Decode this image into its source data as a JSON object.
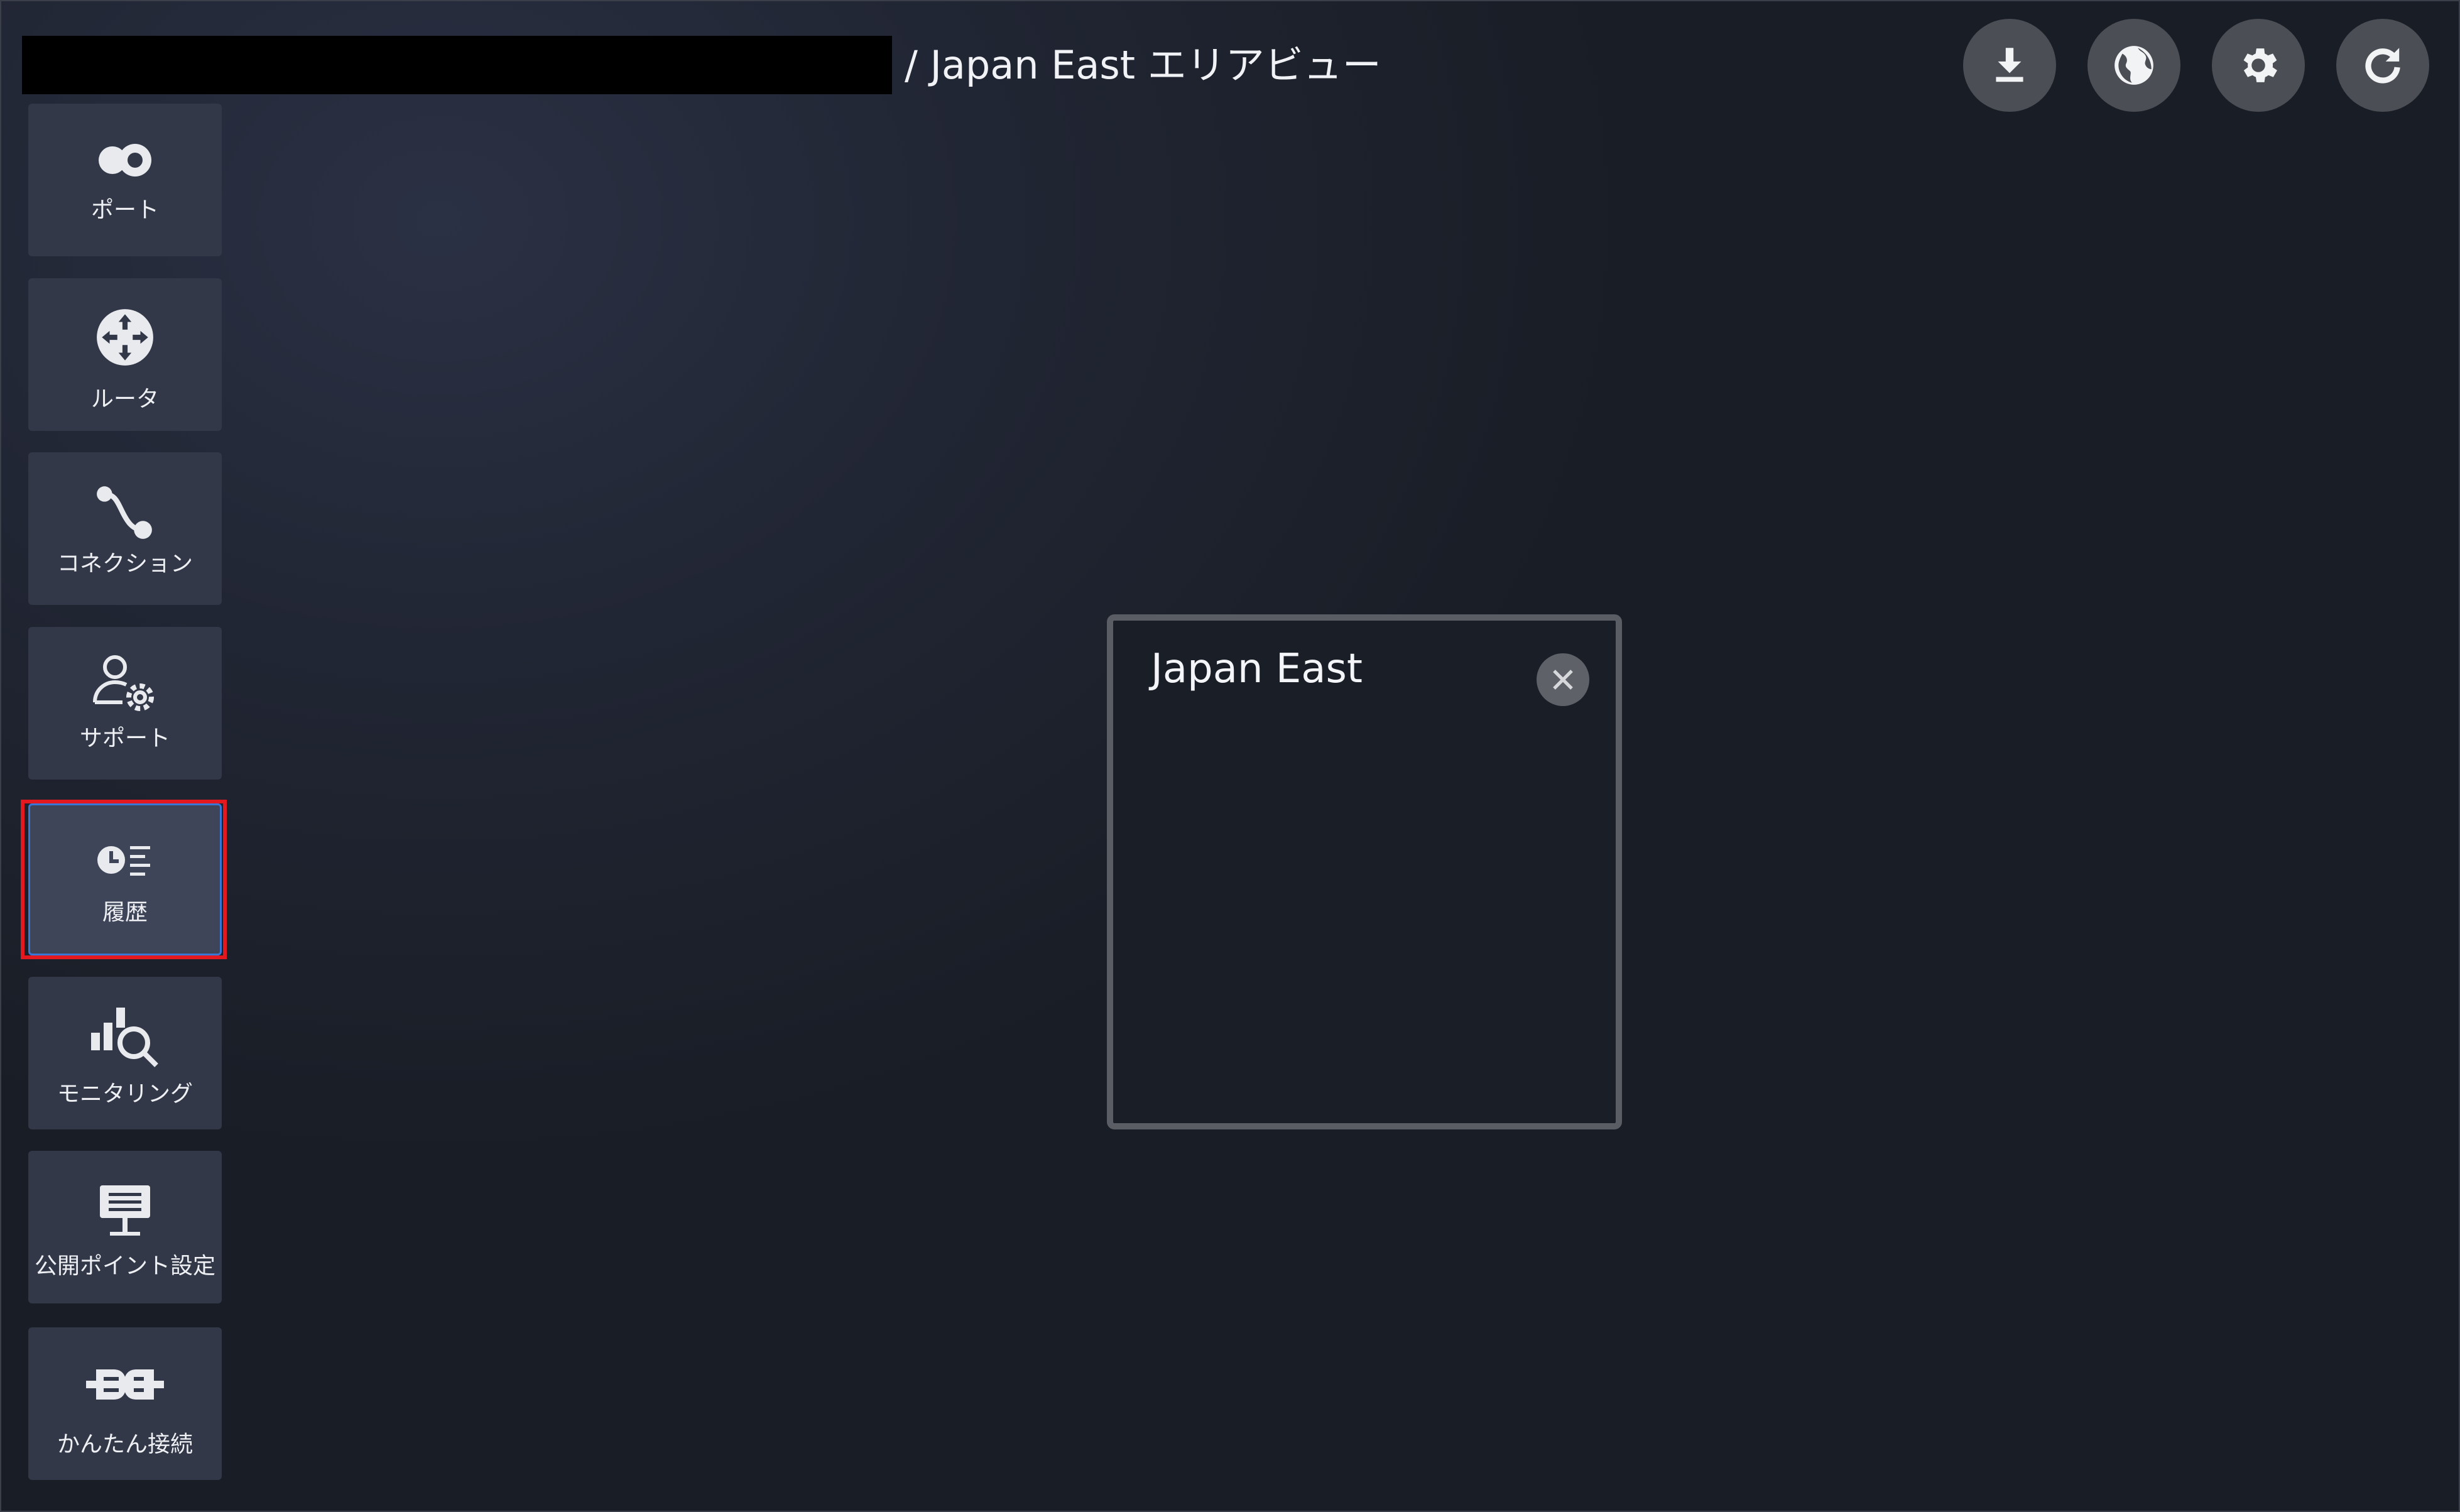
{
  "header": {
    "breadcrumb": "/ Japan East エリアビュー",
    "actions": [
      {
        "icon": "download-icon"
      },
      {
        "icon": "globe-icon"
      },
      {
        "icon": "gear-icon"
      },
      {
        "icon": "refresh-icon"
      }
    ]
  },
  "sidebar": {
    "items": [
      {
        "label": "ポート",
        "icon": "port-toggle-icon"
      },
      {
        "label": "ルータ",
        "icon": "router-icon"
      },
      {
        "label": "コネクション",
        "icon": "connection-icon"
      },
      {
        "label": "サポート",
        "icon": "support-user-gear-icon"
      },
      {
        "label": "履歴",
        "icon": "history-clock-list-icon",
        "selected": true
      },
      {
        "label": "モニタリング",
        "icon": "monitoring-chart-search-icon"
      },
      {
        "label": "公開ポイント設定",
        "icon": "public-point-board-icon"
      },
      {
        "label": "かんたん接続",
        "icon": "easy-connect-plug-icon"
      }
    ]
  },
  "popup": {
    "title": "Japan East",
    "close_icon": "close-icon"
  },
  "colors": {
    "background": "#1d212b",
    "sidebar_tile": "#323848",
    "selected_outline": "#e3191f",
    "selected_border": "#3977d6",
    "button_bg": "#4b4e55"
  }
}
